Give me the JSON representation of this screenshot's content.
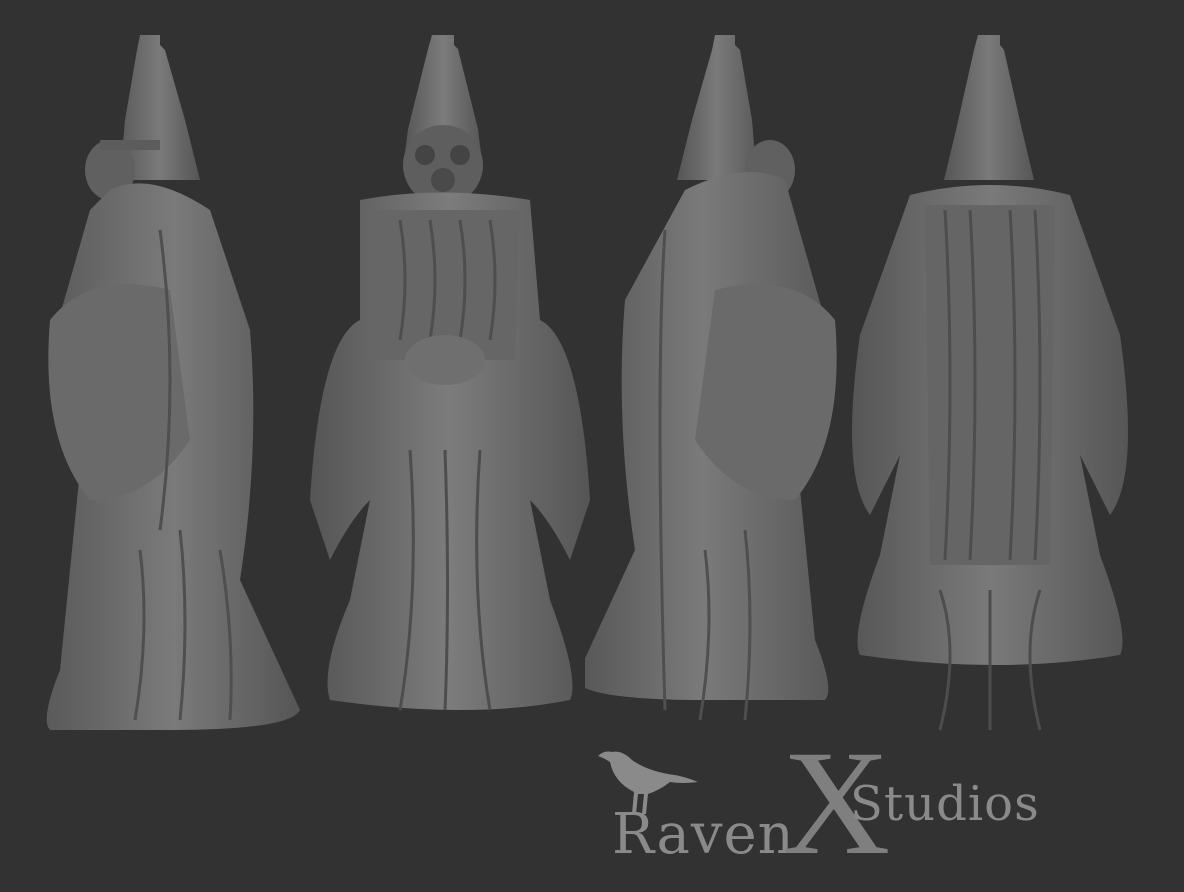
{
  "logo": {
    "text_raven": "Raven",
    "text_x": "X",
    "text_studios": "Studios"
  },
  "figure_views": [
    "left-side",
    "front",
    "right-side",
    "back"
  ],
  "colors": {
    "background": "#323232",
    "figure": "#6e6e6e",
    "figure_shadow": "#4a4a4a",
    "logo": "#8a8a8a"
  }
}
